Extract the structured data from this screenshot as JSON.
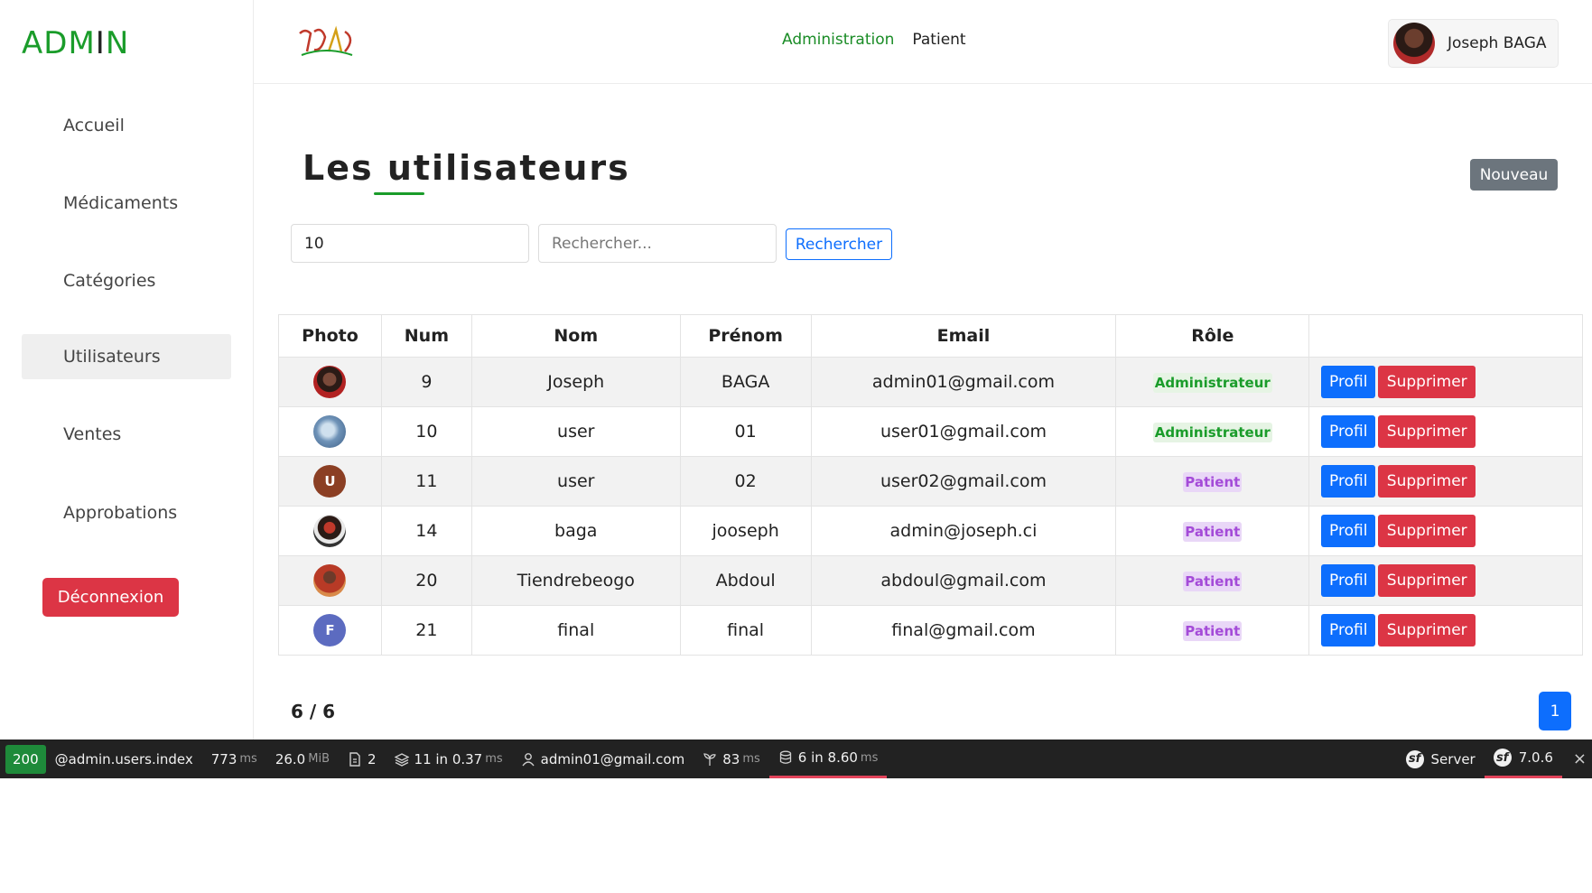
{
  "brand": {
    "part1": "ADM",
    "part2": "I",
    "part3": "N"
  },
  "sidebar": {
    "items": [
      {
        "label": "Accueil"
      },
      {
        "label": "Médicaments"
      },
      {
        "label": "Catégories"
      },
      {
        "label": "Utilisateurs"
      },
      {
        "label": "Ventes"
      },
      {
        "label": "Approbations"
      }
    ],
    "logout_label": "Déconnexion"
  },
  "header": {
    "nav": [
      {
        "label": "Administration"
      },
      {
        "label": "Patient"
      }
    ],
    "user_name": "Joseph BAGA"
  },
  "main": {
    "title_part1": "Les ",
    "title_part2": "utilisateurs",
    "new_button": "Nouveau",
    "limit_value": "10",
    "search_placeholder": "Rechercher...",
    "search_button": "Rechercher"
  },
  "table": {
    "headers": [
      "Photo",
      "Num",
      "Nom",
      "Prénom",
      "Email",
      "Rôle",
      ""
    ],
    "rows": [
      {
        "photo": "",
        "num": "9",
        "nom": "Joseph",
        "prenom": "BAGA",
        "email": "admin01@gmail.com",
        "role": "Administrateur",
        "profil": "Profil",
        "supprimer": "Supprimer"
      },
      {
        "photo": "",
        "num": "10",
        "nom": "user",
        "prenom": "01",
        "email": "user01@gmail.com",
        "role": "Administrateur",
        "profil": "Profil",
        "supprimer": "Supprimer"
      },
      {
        "photo": "U",
        "num": "11",
        "nom": "user",
        "prenom": "02",
        "email": "user02@gmail.com",
        "role": "Patient",
        "profil": "Profil",
        "supprimer": "Supprimer"
      },
      {
        "photo": "",
        "num": "14",
        "nom": "baga",
        "prenom": "jooseph",
        "email": "admin@joseph.ci",
        "role": "Patient",
        "profil": "Profil",
        "supprimer": "Supprimer"
      },
      {
        "photo": "",
        "num": "20",
        "nom": "Tiendrebeogo",
        "prenom": "Abdoul",
        "email": "abdoul@gmail.com",
        "role": "Patient",
        "profil": "Profil",
        "supprimer": "Supprimer"
      },
      {
        "photo": "F",
        "num": "21",
        "nom": "final",
        "prenom": "final",
        "email": "final@gmail.com",
        "role": "Patient",
        "profil": "Profil",
        "supprimer": "Supprimer"
      }
    ]
  },
  "pagination": {
    "count": "6 / 6",
    "page": "1"
  },
  "toolbar": {
    "status": "200",
    "route": "@admin.users.index",
    "time": "773",
    "time_unit": "ms",
    "memory": "26.0",
    "memory_unit": "MiB",
    "forms": "2",
    "cache": "11 in 0.37",
    "cache_unit": "ms",
    "user": "admin01@gmail.com",
    "twig": "83",
    "twig_unit": "ms",
    "db": "6 in 8.60",
    "db_unit": "ms",
    "server": "Server",
    "version": "7.0.6"
  },
  "colors": {
    "brand_green": "#1a9c2a",
    "primary": "#0d6efd",
    "danger": "#dc3545",
    "patient_purple": "#a44bd8"
  }
}
